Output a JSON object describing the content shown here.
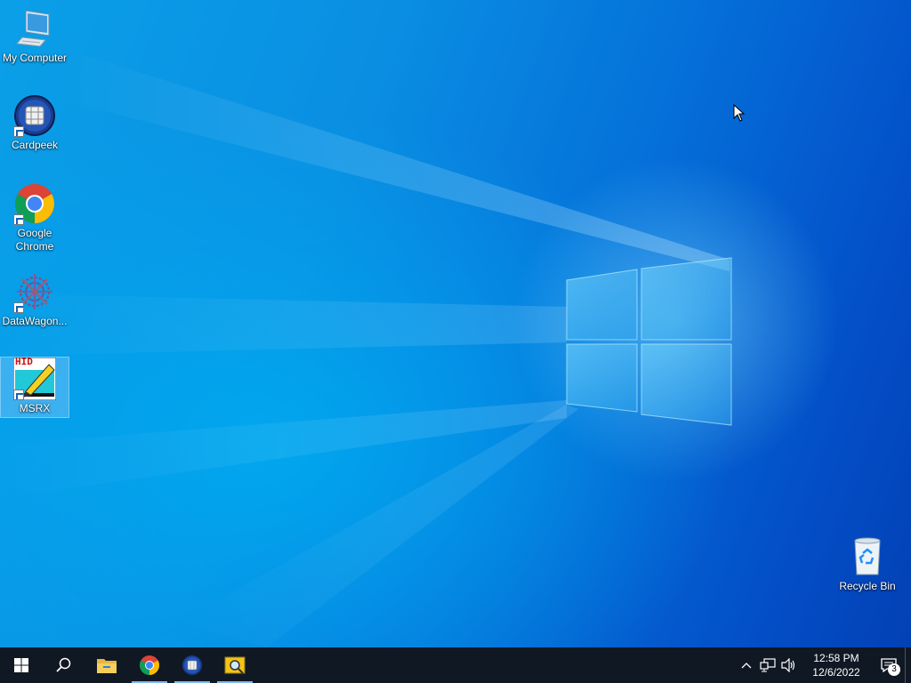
{
  "desktop": {
    "icons": [
      {
        "label": "My Computer",
        "icon": "computer-icon",
        "shortcut": false,
        "selected": false
      },
      {
        "label": "Cardpeek",
        "icon": "cardpeek-icon",
        "shortcut": true,
        "selected": false
      },
      {
        "label": "Google Chrome",
        "icon": "chrome-icon",
        "shortcut": true,
        "selected": false
      },
      {
        "label": "DataWagon...",
        "icon": "datawagon-icon",
        "shortcut": true,
        "selected": false
      },
      {
        "label": "MSRX",
        "icon": "msrx-icon",
        "shortcut": true,
        "selected": true
      },
      {
        "label": "Recycle Bin",
        "icon": "recycle-bin-icon",
        "shortcut": false,
        "selected": false
      }
    ],
    "msrx_badge_text": "HID"
  },
  "taskbar": {
    "pinned": [
      {
        "name": "start-icon"
      },
      {
        "name": "search-icon"
      },
      {
        "name": "file-explorer-icon",
        "active": false
      },
      {
        "name": "chrome-icon",
        "active": true
      },
      {
        "name": "cardpeek-icon",
        "active": true
      },
      {
        "name": "msrx-search-icon",
        "active": true
      }
    ],
    "clock": {
      "time": "12:58 PM",
      "date": "12/6/2022"
    },
    "notification_count": "3"
  },
  "colors": {
    "taskbar": "#101823",
    "accent": "#0078d7"
  }
}
